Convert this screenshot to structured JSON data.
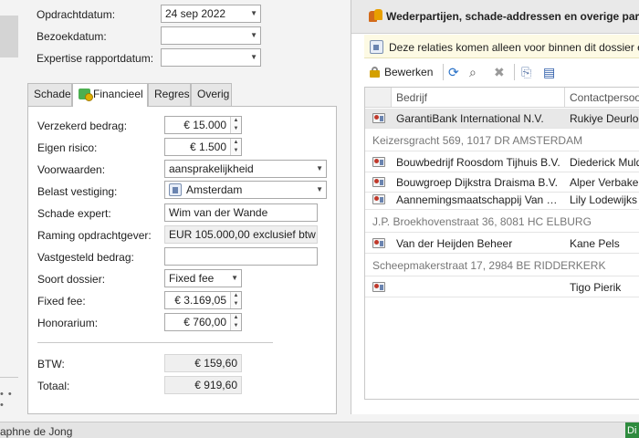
{
  "case_header": {
    "opdrachtdatum_label": "Opdrachtdatum:",
    "opdrachtdatum_value": "24 sep 2022",
    "bezoekdatum_label": "Bezoekdatum:",
    "bezoekdatum_value": "",
    "expertise_label": "Expertise rapportdatum:",
    "expertise_value": ""
  },
  "tabs": [
    {
      "label": "Schade"
    },
    {
      "label": "Financieel",
      "icon": "money-icon",
      "active": true
    },
    {
      "label": "Regres"
    },
    {
      "label": "Overig"
    }
  ],
  "financieel": {
    "verzekerd_label": "Verzekerd bedrag:",
    "verzekerd_value": "€ 15.000",
    "eigen_risico_label": "Eigen risico:",
    "eigen_risico_value": "€ 1.500",
    "voorwaarden_label": "Voorwaarden:",
    "voorwaarden_value": "aansprakelijkheid",
    "belast_label": "Belast vestiging:",
    "belast_value": "Amsterdam",
    "schade_expert_label": "Schade expert:",
    "schade_expert_value": "Wim van der Wande",
    "raming_label": "Raming opdrachtgever:",
    "raming_value": "EUR 105.000,00 exclusief btw",
    "vastgesteld_label": "Vastgesteld bedrag:",
    "vastgesteld_value": "",
    "soort_label": "Soort dossier:",
    "soort_value": "Fixed fee",
    "fixed_fee_label": "Fixed fee:",
    "fixed_fee_value": "€ 3.169,05",
    "honorarium_label": "Honorarium:",
    "honorarium_value": "€ 760,00",
    "btw_label": "BTW:",
    "btw_value": "€ 159,60",
    "totaal_label": "Totaal:",
    "totaal_value": "€ 919,60"
  },
  "right_panel": {
    "title": "Wederpartijen, schade-addressen en overige partijen",
    "info_text": "Deze relaties komen alleen voor binnen dit dossier en",
    "toolbar": {
      "edit_label": "Bewerken"
    },
    "columns": {
      "bedrijf": "Bedrijf",
      "contact": "Contactpersoon"
    },
    "rows": [
      {
        "type": "relation",
        "company": "GarantiBank International N.V.",
        "contact": "Rukiye Deurloo",
        "selected": true
      },
      {
        "type": "address",
        "text": "Keizersgracht 569, 1017 DR  AMSTERDAM"
      },
      {
        "type": "relation",
        "company": "Bouwbedrijf Roosdom Tijhuis B.V.",
        "contact": "Diederick Mulder"
      },
      {
        "type": "relation",
        "company": "Bouwgroep Dijkstra Draisma B.V.",
        "contact": "Alper Verbakel"
      },
      {
        "type": "relation",
        "company": "Aannemingsmaatschappij Van Gelder",
        "contact": "Lily Lodewijks"
      },
      {
        "type": "address",
        "text": "J.P. Broekhovenstraat 36, 8081 HC  ELBURG"
      },
      {
        "type": "relation",
        "company": "Van der Heijden Beheer",
        "contact": "Kane Pels"
      },
      {
        "type": "address",
        "text": "Scheepmakerstraat 17, 2984 BE  RIDDERKERK"
      },
      {
        "type": "relation",
        "company": "",
        "contact": "Tigo Pierik"
      }
    ]
  },
  "status_bar": {
    "user": "aphne de Jong",
    "right_label": "Di"
  }
}
